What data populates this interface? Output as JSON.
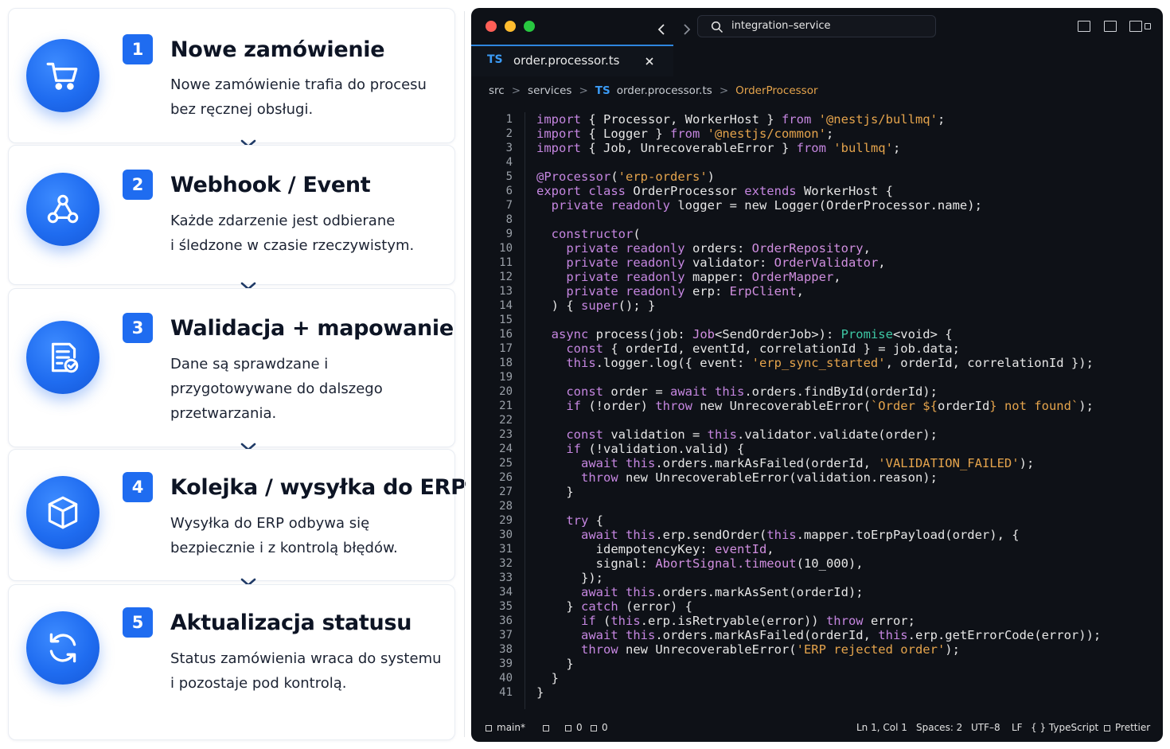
{
  "steps": [
    {
      "number": "1",
      "title": "Nowe zamówienie",
      "desc_line1": "Nowe zamówienie trafia do procesu",
      "desc_line2": "bez ręcznej obsługi.",
      "icon": "cart-icon"
    },
    {
      "number": "2",
      "title": "Webhook / Event",
      "desc_line1": "Każde zdarzenie jest odbierane",
      "desc_line2": "i śledzone w czasie rzeczywistym.",
      "icon": "webhook-icon"
    },
    {
      "number": "3",
      "title": "Walidacja + mapowanie",
      "desc_line1": "Dane są sprawdzane i",
      "desc_line2": "przygotowywane do dalszego",
      "desc_line3": "przetwarzania.",
      "icon": "document-check-icon"
    },
    {
      "number": "4",
      "title": "Kolejka / wysyłka do ERP",
      "desc_line1": "Wysyłka do ERP odbywa się",
      "desc_line2": "bezpiecznie i z kontrolą błędów.",
      "icon": "cube-icon"
    },
    {
      "number": "5",
      "title": "Aktualizacja statusu",
      "desc_line1": "Status zamówienia wraca do systemu",
      "desc_line2": "i pozostaje pod kontrolą.",
      "icon": "refresh-icon"
    }
  ],
  "editor": {
    "search": "integration–service",
    "tab": {
      "lang": "TS",
      "filename": "order.processor.ts"
    },
    "breadcrumb": {
      "src": "src",
      "services": "services",
      "lang": "TS",
      "file": "order.processor.ts",
      "symbol": "OrderProcessor"
    },
    "status": {
      "branch": "main*",
      "errors": "0",
      "warnings": "0",
      "position": "Ln 1, Col 1",
      "spaces": "Spaces: 2",
      "encoding": "UTF–8",
      "eol": "LF",
      "language": "{ } TypeScript",
      "formatter": "Prettier"
    },
    "colors": {
      "keyword": "#c586e0",
      "string": "#e5a44c",
      "type": "#3ec8a4",
      "accent": "#2e86de"
    },
    "code_lines": [
      {
        "n": "1",
        "html": "<span class=\"kw\">import</span> { Processor, WorkerHost } <span class=\"kw\">from</span> <span class=\"str\">'@nestjs/bullmq'</span>;"
      },
      {
        "n": "2",
        "html": "<span class=\"kw\">import</span> { Logger } <span class=\"kw\">from</span> <span class=\"str\">'@nestjs/common'</span>;"
      },
      {
        "n": "3",
        "html": "<span class=\"kw\">import</span> { Job, UnrecoverableError } <span class=\"kw\">from</span> <span class=\"str\">'bullmq'</span>;"
      },
      {
        "n": "4",
        "html": ""
      },
      {
        "n": "5",
        "html": "<span class=\"dec\">@Processor</span>(<span class=\"str\">'erp-orders'</span>)"
      },
      {
        "n": "6",
        "html": "<span class=\"kw\">export class</span> OrderProcessor <span class=\"kw\">extends</span> WorkerHost {"
      },
      {
        "n": "7",
        "html": "  <span class=\"kw\">private readonly</span> logger = new Logger(OrderProcessor.name);"
      },
      {
        "n": "8",
        "html": ""
      },
      {
        "n": "9",
        "html": "  <span class=\"kw\">constructor</span>("
      },
      {
        "n": "10",
        "html": "    <span class=\"kw\">private readonly</span> orders: <span class=\"typ\">OrderRepository</span>,"
      },
      {
        "n": "11",
        "html": "    <span class=\"kw\">private readonly</span> validator: <span class=\"typ\">OrderValidator</span>,"
      },
      {
        "n": "12",
        "html": "    <span class=\"kw\">private readonly</span> mapper: <span class=\"typ\">OrderMapper</span>,"
      },
      {
        "n": "13",
        "html": "    <span class=\"kw\">private readonly</span> erp: <span class=\"typ\">ErpClient</span>,"
      },
      {
        "n": "14",
        "html": "  ) { <span class=\"kw\">super</span>(); }"
      },
      {
        "n": "15",
        "html": ""
      },
      {
        "n": "16",
        "html": "  <span class=\"kw\">async</span> process(job: <span class=\"typ\">Job</span>&lt;SendOrderJob&gt;): <span class=\"prm\">Promise</span>&lt;void&gt; {"
      },
      {
        "n": "17",
        "html": "    <span class=\"kw\">const</span> { orderId, eventId, correlationId } = job.data;"
      },
      {
        "n": "18",
        "html": "    <span class=\"kw\">this</span>.logger.log({ event: <span class=\"str\">'erp_sync_started'</span>, orderId, correlationId });"
      },
      {
        "n": "19",
        "html": ""
      },
      {
        "n": "20",
        "html": "    <span class=\"kw\">const</span> order = <span class=\"kw\">await this</span>.orders.findById(orderId);"
      },
      {
        "n": "21",
        "html": "    <span class=\"kw\">if</span> (!order) <span class=\"kw\">throw</span> new UnrecoverableError(<span class=\"str\">`Order ${</span>orderId<span class=\"str\">} not found`</span>);"
      },
      {
        "n": "22",
        "html": ""
      },
      {
        "n": "23",
        "html": "    <span class=\"kw\">const</span> validation = <span class=\"kw\">this</span>.validator.validate(order);"
      },
      {
        "n": "24",
        "html": "    <span class=\"kw\">if</span> (!validation.valid) {"
      },
      {
        "n": "25",
        "html": "      <span class=\"kw\">await this</span>.orders.markAsFailed(orderId, <span class=\"str\">'VALIDATION_FAILED'</span>);"
      },
      {
        "n": "26",
        "html": "      <span class=\"kw\">throw</span> new UnrecoverableError(validation.reason);"
      },
      {
        "n": "27",
        "html": "    }"
      },
      {
        "n": "28",
        "html": ""
      },
      {
        "n": "29",
        "html": "    <span class=\"kw\">try</span> {"
      },
      {
        "n": "30",
        "html": "      <span class=\"kw\">await this</span>.erp.sendOrder(<span class=\"kw\">this</span>.mapper.toErpPayload(order), {"
      },
      {
        "n": "31",
        "html": "        idempotencyKey: <span class=\"typ\">eventId</span>,"
      },
      {
        "n": "32",
        "html": "        signal: <span class=\"typ\">AbortSignal.timeout</span>(10_000),"
      },
      {
        "n": "33",
        "html": "      });"
      },
      {
        "n": "34",
        "html": "      <span class=\"kw\">await this</span>.orders.markAsSent(orderId);"
      },
      {
        "n": "35",
        "html": "    } <span class=\"kw\">catch</span> (error) {"
      },
      {
        "n": "36",
        "html": "      <span class=\"kw\">if</span> (<span class=\"kw\">this</span>.erp.isRetryable(error)) <span class=\"kw\">throw</span> error;"
      },
      {
        "n": "37",
        "html": "      <span class=\"kw\">await this</span>.orders.markAsFailed(orderId, <span class=\"kw\">this</span>.erp.getErrorCode(error));"
      },
      {
        "n": "38",
        "html": "      <span class=\"kw\">throw</span> new UnrecoverableError(<span class=\"str\">'ERP rejected order'</span>);"
      },
      {
        "n": "39",
        "html": "    }"
      },
      {
        "n": "40",
        "html": "  }"
      },
      {
        "n": "41",
        "html": "}"
      }
    ]
  }
}
